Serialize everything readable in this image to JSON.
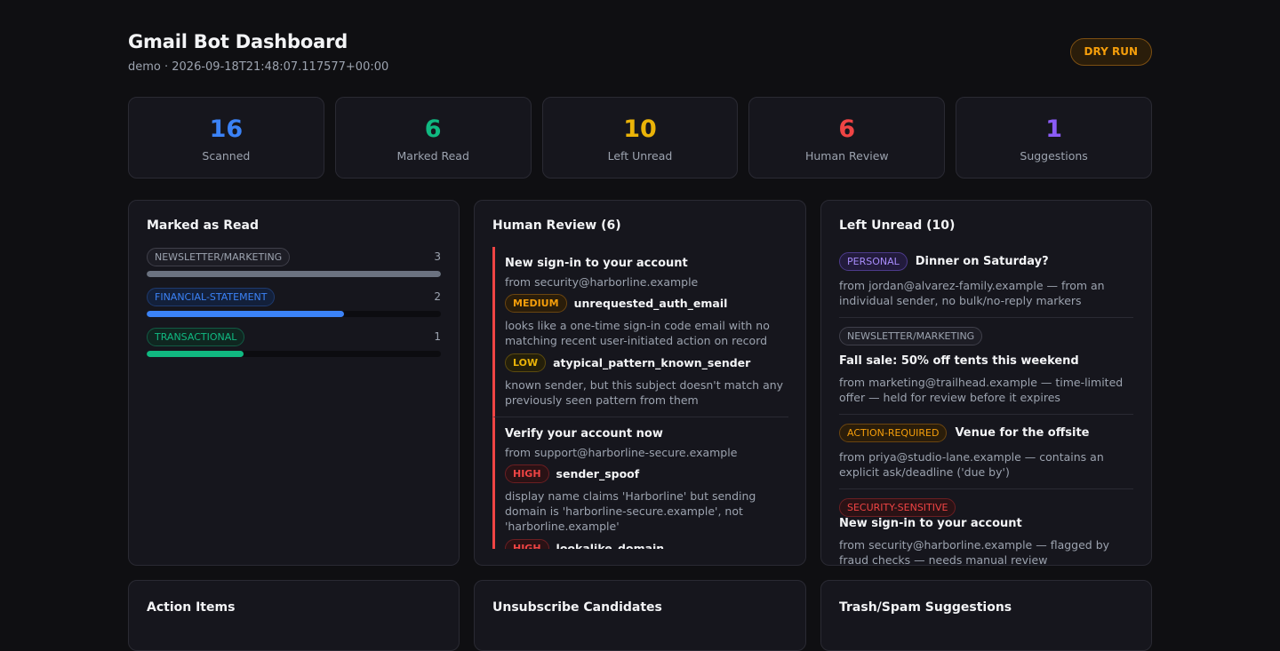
{
  "header": {
    "title": "Gmail Bot Dashboard",
    "subtitle": "demo · 2026-09-18T21:48:07.117577+00:00",
    "mode_badge": "DRY RUN"
  },
  "stats": [
    {
      "value": "16",
      "label": "Scanned",
      "color": "#3b82f6"
    },
    {
      "value": "6",
      "label": "Marked Read",
      "color": "#10b981"
    },
    {
      "value": "10",
      "label": "Left Unread",
      "color": "#eab308"
    },
    {
      "value": "6",
      "label": "Human Review",
      "color": "#ef4444"
    },
    {
      "value": "1",
      "label": "Suggestions",
      "color": "#8b5cf6"
    }
  ],
  "marked_read": {
    "title": "Marked as Read",
    "categories": [
      {
        "label": "NEWSLETTER/MARKETING",
        "count": "3",
        "fraction": 1.0,
        "color": "#6b7280"
      },
      {
        "label": "FINANCIAL-STATEMENT",
        "count": "2",
        "fraction": 0.67,
        "color": "#3b82f6"
      },
      {
        "label": "TRANSACTIONAL",
        "count": "1",
        "fraction": 0.33,
        "color": "#10b981"
      }
    ]
  },
  "human_review": {
    "title": "Human Review (6)",
    "items": [
      {
        "subject": "New sign-in to your account",
        "from": "from security@harborline.example",
        "flags": [
          {
            "severity": "MEDIUM",
            "code": "unrequested_auth_email",
            "desc": "looks like a one-time sign-in code email with no matching recent user-initiated action on record"
          },
          {
            "severity": "LOW",
            "code": "atypical_pattern_known_sender",
            "desc": "known sender, but this subject doesn't match any previously seen pattern from them"
          }
        ]
      },
      {
        "subject": "Verify your account now",
        "from": "from support@harborline-secure.example",
        "flags": [
          {
            "severity": "HIGH",
            "code": "sender_spoof",
            "desc": "display name claims 'Harborline' but sending domain is 'harborline-secure.example', not 'harborline.example'"
          },
          {
            "severity": "HIGH",
            "code": "lookalike_domain",
            "desc": ""
          }
        ]
      }
    ]
  },
  "left_unread": {
    "title": "Left Unread (10)",
    "items": [
      {
        "tag": "PERSONAL",
        "subject": "Dinner on Saturday?",
        "desc": "from jordan@alvarez-family.example — from an individual sender, no bulk/no-reply markers"
      },
      {
        "tag": "NEWSLETTER/MARKETING",
        "subject": "Fall sale: 50% off tents this weekend",
        "desc": "from marketing@trailhead.example — time-limited offer — held for review before it expires"
      },
      {
        "tag": "ACTION-REQUIRED",
        "subject": "Venue for the offsite",
        "desc": "from priya@studio-lane.example — contains an explicit ask/deadline ('due by')"
      },
      {
        "tag": "SECURITY-SENSITIVE",
        "subject": "New sign-in to your account",
        "desc": "from security@harborline.example — flagged by fraud checks — needs manual review"
      }
    ]
  },
  "bottom_panels": {
    "action_items": "Action Items",
    "unsubscribe": "Unsubscribe Candidates",
    "trash_spam": "Trash/Spam Suggestions"
  }
}
